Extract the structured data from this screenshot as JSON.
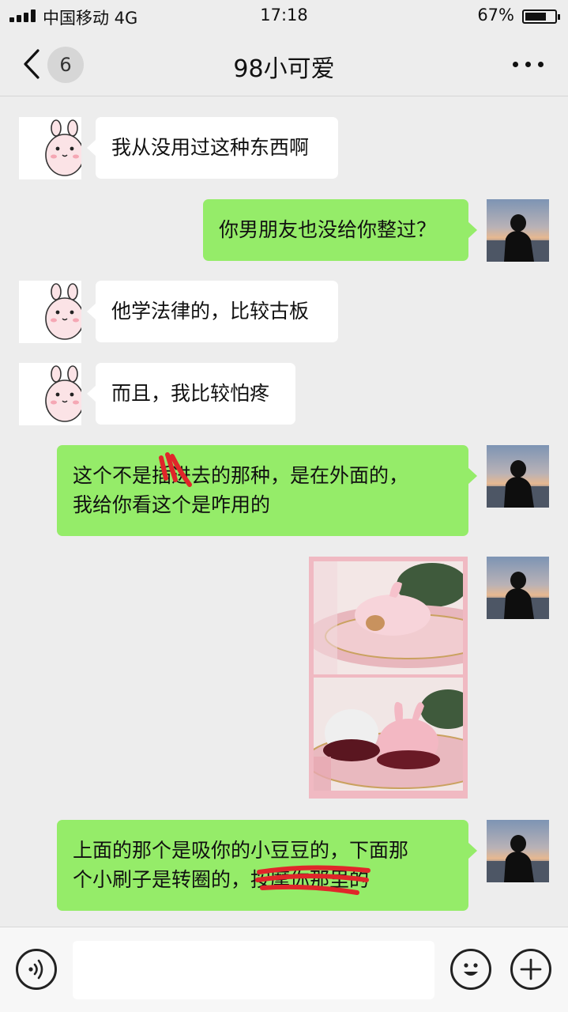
{
  "status_bar": {
    "carrier": "中国移动 4G",
    "time": "17:18",
    "battery": "67%"
  },
  "nav": {
    "unread_count": "6",
    "title": "98小可爱"
  },
  "messages": [
    {
      "side": "in",
      "text": "我从没用过这种东西啊"
    },
    {
      "side": "out",
      "text": "你男朋友也没给你整过？"
    },
    {
      "side": "in",
      "text": "他学法律的，比较古板"
    },
    {
      "side": "in",
      "text": "而且，我比较怕疼"
    },
    {
      "side": "out",
      "line1": "这个不是插进去的那种，是在外面的，",
      "line2": "我给你看这个是咋用的"
    },
    {
      "side": "out",
      "type": "image",
      "icon": "product-photo"
    },
    {
      "side": "out",
      "line1": "上面的那个是吸你的小豆豆的，下面那",
      "line2": "个小刷子是转圈的，按摩你那里的"
    }
  ],
  "colors": {
    "background": "#ededed",
    "bubble_out": "#95ec69",
    "bubble_in": "#ffffff",
    "redaction": "#e0262a"
  },
  "input_bar": {
    "voice_icon": "voice-icon",
    "emoji_icon": "emoji-icon",
    "plus_icon": "plus-icon"
  }
}
